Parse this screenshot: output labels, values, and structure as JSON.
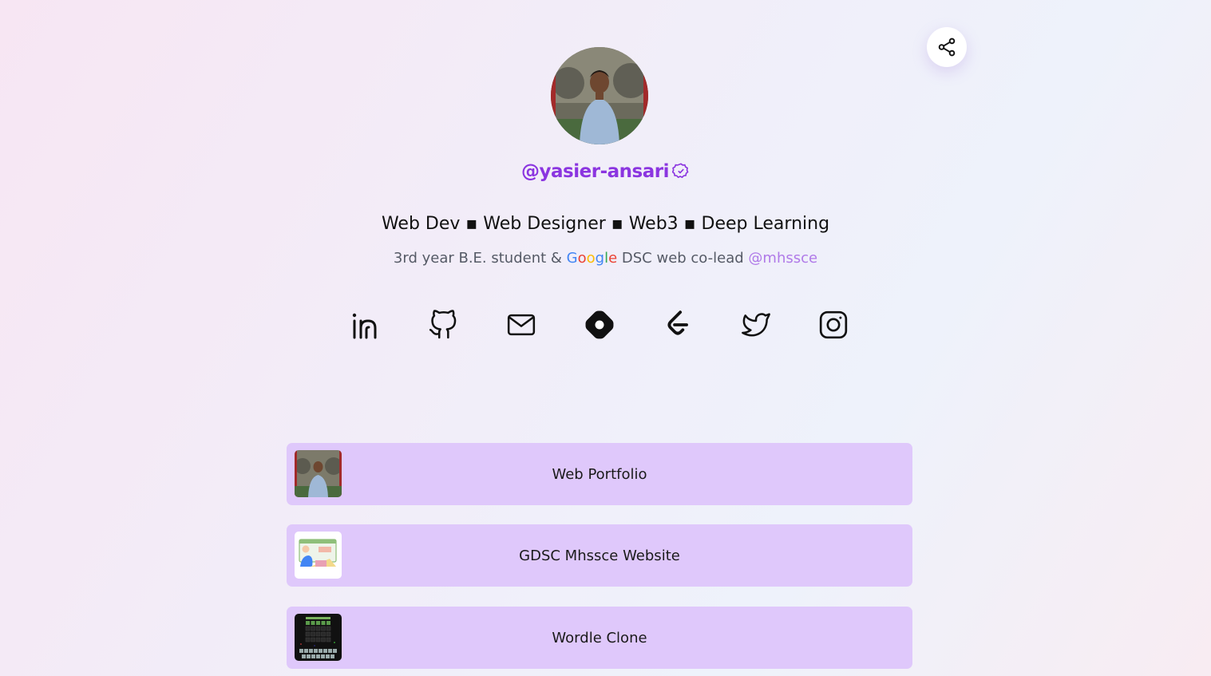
{
  "header": {
    "share_icon": "share-icon"
  },
  "profile": {
    "username": "@yasier-ansari",
    "verified_icon": "verified-badge-icon",
    "tagline": "Web Dev ▪ Web Designer ▪ Web3 ▪ Deep Learning",
    "bio_prefix": "3rd year B.E. student & ",
    "bio_google": [
      "G",
      "o",
      "o",
      "g",
      "l",
      "e"
    ],
    "bio_middle": " DSC web co-lead ",
    "bio_handle": "@mhssce"
  },
  "socials": [
    {
      "name": "linkedin",
      "icon": "linkedin-icon"
    },
    {
      "name": "github",
      "icon": "github-icon"
    },
    {
      "name": "email",
      "icon": "mail-icon"
    },
    {
      "name": "hashnode",
      "icon": "hashnode-icon"
    },
    {
      "name": "leetcode",
      "icon": "leetcode-icon"
    },
    {
      "name": "twitter",
      "icon": "twitter-icon"
    },
    {
      "name": "instagram",
      "icon": "instagram-icon"
    }
  ],
  "links": [
    {
      "label": "Web Portfolio"
    },
    {
      "label": "GDSC Mhssce Website"
    },
    {
      "label": "Wordle Clone"
    }
  ],
  "colors": {
    "accent": "#8b35e0",
    "card_bg": "#dfc8fb",
    "handle": "#b07ae8"
  }
}
